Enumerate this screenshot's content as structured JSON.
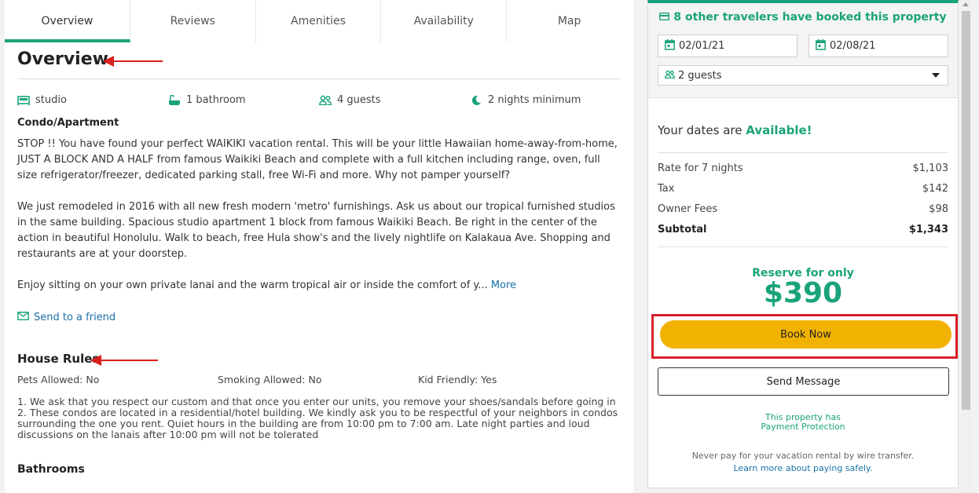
{
  "tabs": [
    "Overview",
    "Reviews",
    "Amenities",
    "Availability",
    "Map"
  ],
  "overview": {
    "title": "Overview",
    "facts": [
      {
        "icon": "bed-icon",
        "label": "studio"
      },
      {
        "icon": "bathtub-icon",
        "label": "1 bathroom"
      },
      {
        "icon": "guests-icon",
        "label": "4 guests"
      },
      {
        "icon": "moon-icon",
        "label": "2 nights minimum"
      }
    ],
    "property_type": "Condo/Apartment",
    "para1": "STOP !! You have found your perfect WAIKIKI vacation rental. This will be your little Hawaiian home-away-from-home, JUST A BLOCK AND A HALF from famous Waikiki Beach and complete with a full kitchen including range, oven, full size refrigerator/freezer, dedicated parking stall, free Wi-Fi and more. Why not pamper yourself?",
    "para2": "We just remodeled in 2016 with all new fresh modern 'metro' furnishings. Ask us about our tropical furnished studios in the same building. Spacious studio apartment 1 block from famous Waikiki Beach. Be right in the center of the action in beautiful Honolulu. Walk to beach, free Hula show's and the lively nightlife on Kalakaua Ave. Shopping and restaurants are at your doorstep.",
    "para3": "Enjoy sitting on your own private lanai and the warm tropical air or inside the comfort of y...",
    "more_label": "More",
    "send_friend": "Send to a friend"
  },
  "house_rules": {
    "title": "House Rules",
    "pets": "Pets Allowed: No",
    "smoking": "Smoking Allowed: No",
    "kids": "Kid Friendly: Yes",
    "text": "1. We ask that you respect our custom and that once you enter our units, you remove your shoes/sandals before going in 2. These condos are located in a residential/hotel building. We kindly ask you to be respectful of your neighbors in condos surrounding the one you rent. Quiet hours in the building are from 10:00 pm to 7:00 am. Late night parties and loud discussions on the lanais after 10:00 pm will not be tolerated"
  },
  "bathrooms": {
    "title": "Bathrooms"
  },
  "booking": {
    "booked_notice": "8 other travelers have booked this property",
    "checkin": "02/01/21",
    "checkout": "02/08/21",
    "guests": "2 guests",
    "available_prefix": "Your dates are",
    "available_word": "Available!",
    "costs": [
      {
        "label": "Rate for 7 nights",
        "value": "$1,103"
      },
      {
        "label": "Tax",
        "value": "$142"
      },
      {
        "label": "Owner Fees",
        "value": "$98"
      }
    ],
    "subtotal_label": "Subtotal",
    "subtotal_value": "$1,343",
    "reserve_label": "Reserve for only",
    "reserve_price": "$390",
    "book_label": "Book Now",
    "message_label": "Send Message",
    "protection_line1": "This property has",
    "protection_line2": "Payment Protection",
    "wire_warning": "Never pay for your vacation rental by wire transfer.",
    "learn_more": "Learn more about paying safely."
  },
  "colors": {
    "accent": "#1aa37a",
    "book_button": "#f2b200",
    "highlight_frame": "#d8202a",
    "annotation_arrow": "#d9201c",
    "link": "#1a72a8"
  }
}
